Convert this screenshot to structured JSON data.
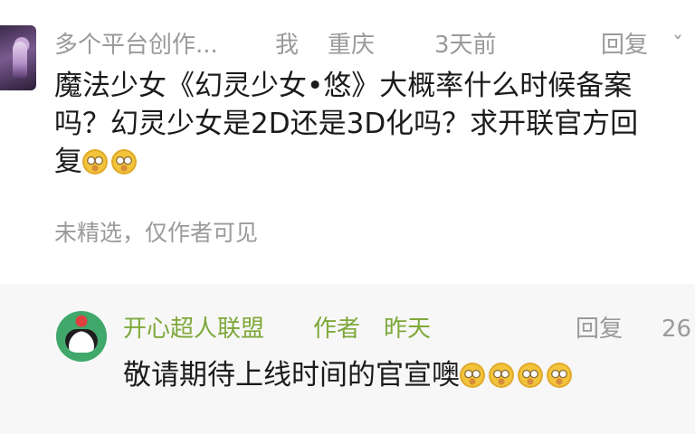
{
  "comment": {
    "author": "多个平台创作...",
    "me_label": "我",
    "location": "重庆",
    "time": "3天前",
    "reply_label": "回复",
    "reply_more": "ˇ",
    "content_lines": [
      "魔法少女《幻灵少女•悠》大概率什么时候备案",
      "吗？幻灵少女是2D还是3D化吗？求开联官方回",
      "复"
    ],
    "content_emojis": [
      "smiling-face-with-tears-emoji",
      "smiling-face-with-tears-emoji"
    ],
    "visibility_note": "未精选，仅作者可见"
  },
  "reply": {
    "author": "开心超人联盟",
    "role": "作者",
    "time": "昨天",
    "reply_label": "回复",
    "like_count": "26",
    "content": "敬请期待上线时间的官宣噢",
    "content_emojis": [
      "thinking-face-emoji",
      "thinking-face-emoji",
      "thinking-face-emoji",
      "thinking-face-emoji"
    ]
  },
  "colors": {
    "meta_gray": "#9a9a9a",
    "author_green": "#7ea83a",
    "text": "#1b1b1b",
    "reply_bg": "#f7f7f7"
  }
}
